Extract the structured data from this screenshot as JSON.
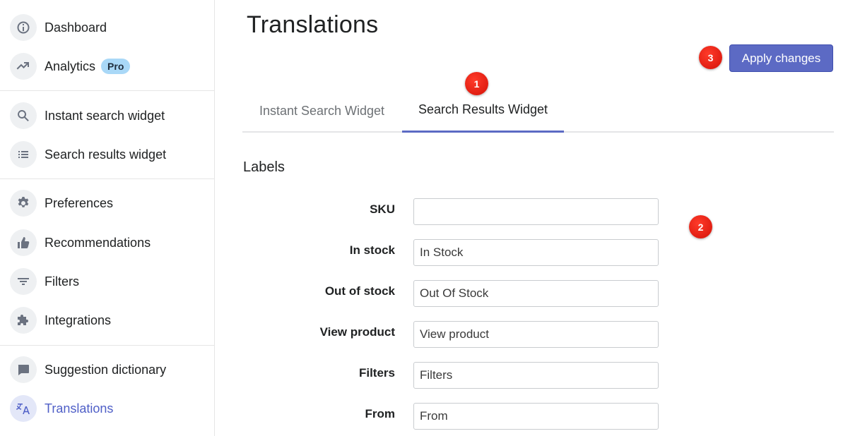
{
  "sidebar": {
    "items": [
      {
        "label": "Dashboard",
        "icon": "info-icon"
      },
      {
        "label": "Analytics",
        "icon": "trending-up-icon",
        "badge": "Pro"
      },
      {
        "label": "Instant search widget",
        "icon": "search-icon"
      },
      {
        "label": "Search results widget",
        "icon": "list-icon"
      },
      {
        "label": "Preferences",
        "icon": "gear-icon"
      },
      {
        "label": "Recommendations",
        "icon": "thumbs-up-icon"
      },
      {
        "label": "Filters",
        "icon": "filter-icon"
      },
      {
        "label": "Integrations",
        "icon": "puzzle-icon"
      },
      {
        "label": "Suggestion dictionary",
        "icon": "chat-bubble-icon"
      },
      {
        "label": "Translations",
        "icon": "translate-icon",
        "active": true
      }
    ]
  },
  "header": {
    "title": "Translations",
    "apply_label": "Apply changes"
  },
  "tabs": [
    {
      "label": "Instant Search Widget",
      "active": false
    },
    {
      "label": "Search Results Widget",
      "active": true
    }
  ],
  "markers": [
    "1",
    "2",
    "3"
  ],
  "section": {
    "title": "Labels"
  },
  "fields": [
    {
      "label": "SKU",
      "value": ""
    },
    {
      "label": "In stock",
      "value": "In Stock"
    },
    {
      "label": "Out of stock",
      "value": "Out Of Stock"
    },
    {
      "label": "View product",
      "value": "View product"
    },
    {
      "label": "Filters",
      "value": "Filters"
    },
    {
      "label": "From",
      "value": "From"
    }
  ],
  "colors": {
    "accent": "#5c6ac4",
    "active_nav": "#4f5fc7",
    "marker": "#e0180c",
    "pro_badge": "#a9d8f7"
  }
}
